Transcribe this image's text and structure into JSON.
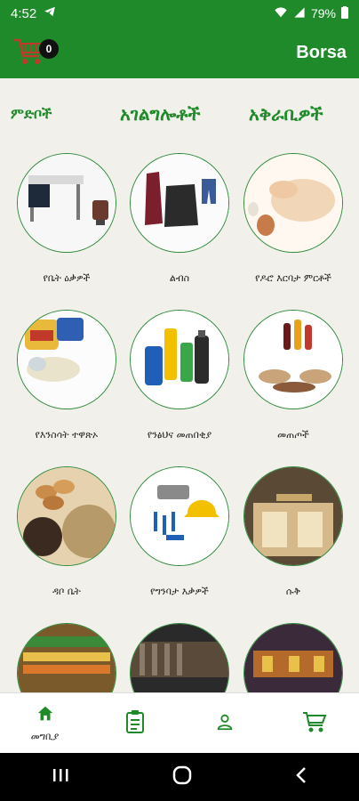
{
  "status": {
    "time": "4:52",
    "battery": "79%"
  },
  "header": {
    "cart_count": "0",
    "brand": "Borsa"
  },
  "tabs": [
    {
      "label": "ምድቦች"
    },
    {
      "label": "አገልግሎቶች"
    },
    {
      "label": "አቅራቢዎች"
    }
  ],
  "categories": [
    {
      "label": "የቤት ዕቃዎች",
      "icon": "furniture-image"
    },
    {
      "label": "ልብስ",
      "icon": "clothes-image"
    },
    {
      "label": "የዶሮ እርባታ ምርቶች",
      "icon": "poultry-image"
    },
    {
      "label": "የእንስሳት ተዋጽኦ",
      "icon": "animal-products-image"
    },
    {
      "label": "የንፅህና መጠበቂያ",
      "icon": "hygiene-image"
    },
    {
      "label": "መጠጦች",
      "icon": "drinks-image"
    },
    {
      "label": "ዳቦ ቤት",
      "icon": "bakery-image"
    },
    {
      "label": "የግንባታ እቃዎች",
      "icon": "construction-image"
    },
    {
      "label": "ሱቅ",
      "icon": "shop-image"
    },
    {
      "label": "",
      "icon": "market-image"
    },
    {
      "label": "",
      "icon": "clothing-store-image"
    },
    {
      "label": "",
      "icon": "restaurant-image"
    }
  ],
  "bottom_nav": {
    "home_label": "መግቢያ"
  },
  "colors": {
    "primary": "#1f8a2a",
    "background": "#f1f0ea"
  }
}
